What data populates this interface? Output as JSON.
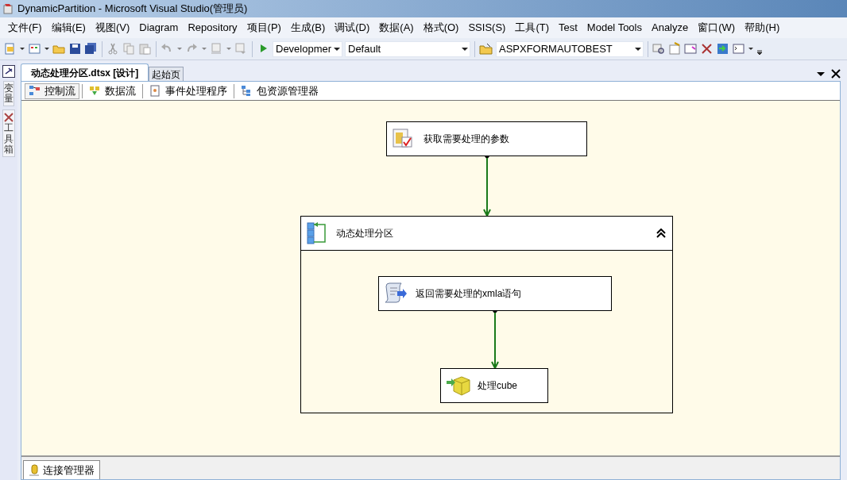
{
  "window": {
    "title": "DynamicPartition - Microsoft Visual Studio(管理员)"
  },
  "menu": [
    "文件(F)",
    "编辑(E)",
    "视图(V)",
    "Diagram",
    "Repository",
    "项目(P)",
    "生成(B)",
    "调试(D)",
    "数据(A)",
    "格式(O)",
    "SSIS(S)",
    "工具(T)",
    "Test",
    "Model Tools",
    "Analyze",
    "窗口(W)",
    "帮助(H)"
  ],
  "toolbar": {
    "configuration": "Developmer",
    "platform": "Default",
    "startup_project": "ASPXFORMAUTOBEST"
  },
  "side_panels": [
    {
      "label": "变量"
    },
    {
      "label": "工具箱"
    }
  ],
  "document_tabs": [
    {
      "label": "动态处理分区.dtsx [设计]",
      "selected": true
    },
    {
      "label": "起始页",
      "selected": false
    }
  ],
  "designer_tabs": [
    {
      "label": "控制流",
      "selected": true
    },
    {
      "label": "数据流",
      "selected": false
    },
    {
      "label": "事件处理程序",
      "selected": false
    },
    {
      "label": "包资源管理器",
      "selected": false
    }
  ],
  "diagram": {
    "nodes": [
      {
        "kind": "task",
        "label": "获取需要处理的参数"
      },
      {
        "kind": "container",
        "label": "动态处理分区",
        "expanded": true,
        "children": [
          {
            "kind": "task",
            "label": "返回需要处理的xmla语句"
          },
          {
            "kind": "task",
            "label": "处理cube"
          }
        ]
      }
    ]
  },
  "bottom_tabs": [
    {
      "label": "连接管理器",
      "selected": true
    }
  ]
}
